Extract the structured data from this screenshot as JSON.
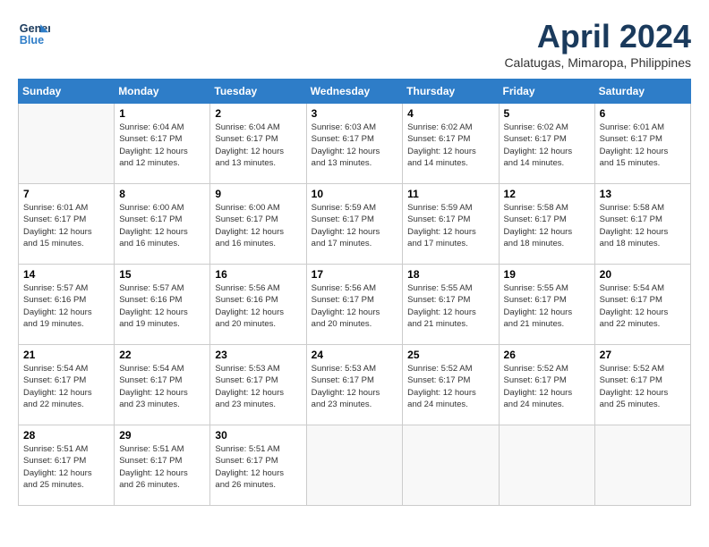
{
  "header": {
    "logo_line1": "General",
    "logo_line2": "Blue",
    "month": "April 2024",
    "location": "Calatugas, Mimaropa, Philippines"
  },
  "weekdays": [
    "Sunday",
    "Monday",
    "Tuesday",
    "Wednesday",
    "Thursday",
    "Friday",
    "Saturday"
  ],
  "weeks": [
    [
      {
        "day": "",
        "info": ""
      },
      {
        "day": "1",
        "info": "Sunrise: 6:04 AM\nSunset: 6:17 PM\nDaylight: 12 hours\nand 12 minutes."
      },
      {
        "day": "2",
        "info": "Sunrise: 6:04 AM\nSunset: 6:17 PM\nDaylight: 12 hours\nand 13 minutes."
      },
      {
        "day": "3",
        "info": "Sunrise: 6:03 AM\nSunset: 6:17 PM\nDaylight: 12 hours\nand 13 minutes."
      },
      {
        "day": "4",
        "info": "Sunrise: 6:02 AM\nSunset: 6:17 PM\nDaylight: 12 hours\nand 14 minutes."
      },
      {
        "day": "5",
        "info": "Sunrise: 6:02 AM\nSunset: 6:17 PM\nDaylight: 12 hours\nand 14 minutes."
      },
      {
        "day": "6",
        "info": "Sunrise: 6:01 AM\nSunset: 6:17 PM\nDaylight: 12 hours\nand 15 minutes."
      }
    ],
    [
      {
        "day": "7",
        "info": "Sunrise: 6:01 AM\nSunset: 6:17 PM\nDaylight: 12 hours\nand 15 minutes."
      },
      {
        "day": "8",
        "info": "Sunrise: 6:00 AM\nSunset: 6:17 PM\nDaylight: 12 hours\nand 16 minutes."
      },
      {
        "day": "9",
        "info": "Sunrise: 6:00 AM\nSunset: 6:17 PM\nDaylight: 12 hours\nand 16 minutes."
      },
      {
        "day": "10",
        "info": "Sunrise: 5:59 AM\nSunset: 6:17 PM\nDaylight: 12 hours\nand 17 minutes."
      },
      {
        "day": "11",
        "info": "Sunrise: 5:59 AM\nSunset: 6:17 PM\nDaylight: 12 hours\nand 17 minutes."
      },
      {
        "day": "12",
        "info": "Sunrise: 5:58 AM\nSunset: 6:17 PM\nDaylight: 12 hours\nand 18 minutes."
      },
      {
        "day": "13",
        "info": "Sunrise: 5:58 AM\nSunset: 6:17 PM\nDaylight: 12 hours\nand 18 minutes."
      }
    ],
    [
      {
        "day": "14",
        "info": "Sunrise: 5:57 AM\nSunset: 6:16 PM\nDaylight: 12 hours\nand 19 minutes."
      },
      {
        "day": "15",
        "info": "Sunrise: 5:57 AM\nSunset: 6:16 PM\nDaylight: 12 hours\nand 19 minutes."
      },
      {
        "day": "16",
        "info": "Sunrise: 5:56 AM\nSunset: 6:16 PM\nDaylight: 12 hours\nand 20 minutes."
      },
      {
        "day": "17",
        "info": "Sunrise: 5:56 AM\nSunset: 6:17 PM\nDaylight: 12 hours\nand 20 minutes."
      },
      {
        "day": "18",
        "info": "Sunrise: 5:55 AM\nSunset: 6:17 PM\nDaylight: 12 hours\nand 21 minutes."
      },
      {
        "day": "19",
        "info": "Sunrise: 5:55 AM\nSunset: 6:17 PM\nDaylight: 12 hours\nand 21 minutes."
      },
      {
        "day": "20",
        "info": "Sunrise: 5:54 AM\nSunset: 6:17 PM\nDaylight: 12 hours\nand 22 minutes."
      }
    ],
    [
      {
        "day": "21",
        "info": "Sunrise: 5:54 AM\nSunset: 6:17 PM\nDaylight: 12 hours\nand 22 minutes."
      },
      {
        "day": "22",
        "info": "Sunrise: 5:54 AM\nSunset: 6:17 PM\nDaylight: 12 hours\nand 23 minutes."
      },
      {
        "day": "23",
        "info": "Sunrise: 5:53 AM\nSunset: 6:17 PM\nDaylight: 12 hours\nand 23 minutes."
      },
      {
        "day": "24",
        "info": "Sunrise: 5:53 AM\nSunset: 6:17 PM\nDaylight: 12 hours\nand 23 minutes."
      },
      {
        "day": "25",
        "info": "Sunrise: 5:52 AM\nSunset: 6:17 PM\nDaylight: 12 hours\nand 24 minutes."
      },
      {
        "day": "26",
        "info": "Sunrise: 5:52 AM\nSunset: 6:17 PM\nDaylight: 12 hours\nand 24 minutes."
      },
      {
        "day": "27",
        "info": "Sunrise: 5:52 AM\nSunset: 6:17 PM\nDaylight: 12 hours\nand 25 minutes."
      }
    ],
    [
      {
        "day": "28",
        "info": "Sunrise: 5:51 AM\nSunset: 6:17 PM\nDaylight: 12 hours\nand 25 minutes."
      },
      {
        "day": "29",
        "info": "Sunrise: 5:51 AM\nSunset: 6:17 PM\nDaylight: 12 hours\nand 26 minutes."
      },
      {
        "day": "30",
        "info": "Sunrise: 5:51 AM\nSunset: 6:17 PM\nDaylight: 12 hours\nand 26 minutes."
      },
      {
        "day": "",
        "info": ""
      },
      {
        "day": "",
        "info": ""
      },
      {
        "day": "",
        "info": ""
      },
      {
        "day": "",
        "info": ""
      }
    ]
  ]
}
